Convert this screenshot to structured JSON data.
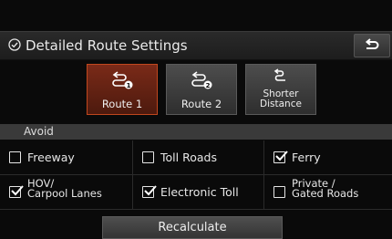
{
  "header": {
    "title": "Detailed Route Settings"
  },
  "routes": [
    {
      "label": "Route 1",
      "badge": "1",
      "selected": true
    },
    {
      "label": "Route 2",
      "badge": "2",
      "selected": false
    },
    {
      "label": "Shorter\nDistance",
      "selected": false
    }
  ],
  "avoid": {
    "label": "Avoid",
    "options": [
      {
        "label": "Freeway",
        "checked": false
      },
      {
        "label": "Toll Roads",
        "checked": false
      },
      {
        "label": "Ferry",
        "checked": true
      },
      {
        "label": "HOV/\nCarpool Lanes",
        "checked": true
      },
      {
        "label": "Electronic Toll",
        "checked": true
      },
      {
        "label": "Private /\nGated Roads",
        "checked": false
      }
    ]
  },
  "recalculate_label": "Recalculate",
  "colors": {
    "selected_route": "#7a2a18",
    "selected_border": "#c0471e"
  }
}
